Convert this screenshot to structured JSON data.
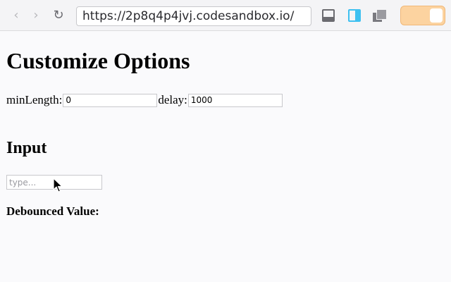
{
  "browser": {
    "url": "https://2p8q4p4jvj.codesandbox.io/",
    "back_glyph": "‹",
    "forward_glyph": "›",
    "reload_glyph": "↻",
    "icons": [
      "back-icon",
      "forward-icon",
      "reload-icon",
      "layout-bottom-icon",
      "layout-side-icon",
      "layout-overlap-icon"
    ],
    "accent_color": "#3ec0f0",
    "toggle_color": "#fcd3a0"
  },
  "page": {
    "title": "Customize Options",
    "options": {
      "min_length_label": "minLength:",
      "min_length_value": "0",
      "delay_label": "delay:",
      "delay_value": "1000"
    },
    "input_section": {
      "heading": "Input",
      "placeholder": "type...",
      "value": ""
    },
    "debounced_label": "Debounced Value:"
  }
}
